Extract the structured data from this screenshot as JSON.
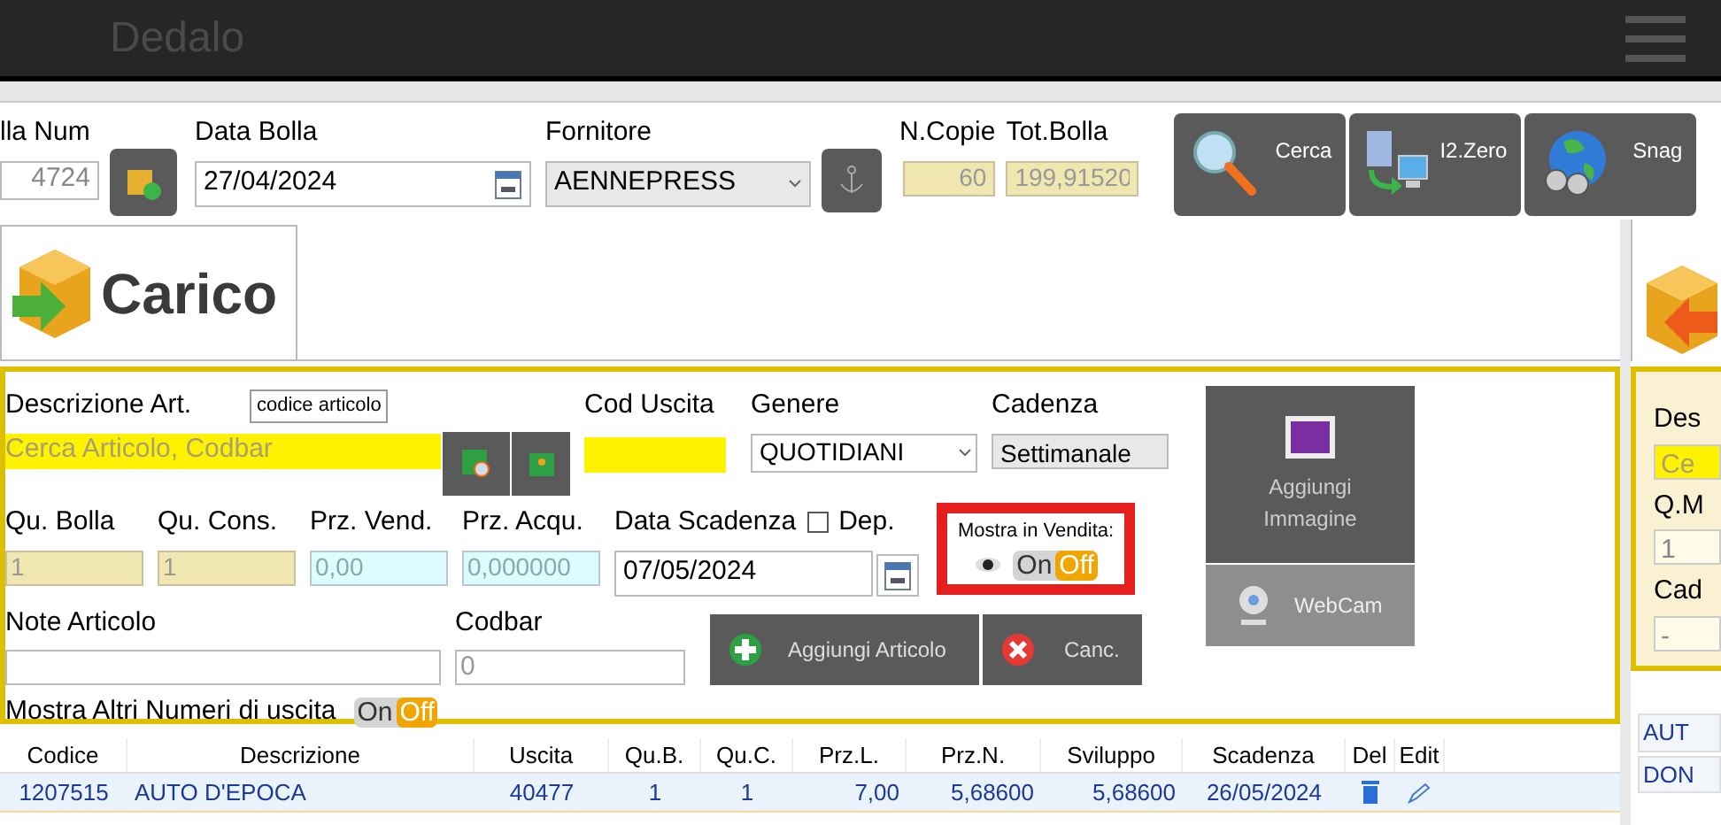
{
  "app_bar": {
    "title": "Dedalo"
  },
  "header": {
    "bolla_num": {
      "label": "lla Num",
      "value": "4724"
    },
    "data_bolla": {
      "label": "Data Bolla",
      "value": "27/04/2024"
    },
    "fornitore": {
      "label": "Fornitore",
      "value": "AENNEPRESS"
    },
    "n_copie": {
      "label": "N.Copie",
      "value": "60"
    },
    "tot_bolla": {
      "label": "Tot.Bolla",
      "value": "199,91520"
    },
    "toolbar_buttons": [
      {
        "kind": "search",
        "label": "Cerca"
      },
      {
        "kind": "transfer",
        "label": "I2.Zero"
      },
      {
        "kind": "globe",
        "label": "Snag"
      }
    ]
  },
  "tab": {
    "label": "Carico"
  },
  "form": {
    "descrizione": {
      "label": "Descrizione Art.",
      "mode": "codice articolo",
      "placeholder": "Cerca Articolo, Codbar"
    },
    "cod_uscita": {
      "label": "Cod Uscita"
    },
    "genere": {
      "label": "Genere",
      "value": "QUOTIDIANI"
    },
    "cadenza": {
      "label": "Cadenza",
      "value": "Settimanale"
    },
    "qty_fields": [
      {
        "label": "Qu. Bolla",
        "value": "1",
        "kind": "quantity"
      },
      {
        "label": "Qu. Cons.",
        "value": "1",
        "kind": "quantity"
      },
      {
        "label": "Prz. Vend.",
        "value": "0,00",
        "kind": "price"
      },
      {
        "label": "Prz. Acqu.",
        "value": "0,000000",
        "kind": "price"
      }
    ],
    "data_scadenza": {
      "label": "Data Scadenza",
      "value": "07/05/2024"
    },
    "deposito": {
      "label": "Dep.",
      "checked": false
    },
    "mostra_in_vendita": {
      "label": "Mostra in Vendita:",
      "on": false,
      "on_label": "On",
      "off_label": "Off"
    },
    "note_articolo": {
      "label": "Note Articolo"
    },
    "codbar": {
      "label": "Codbar",
      "value": "0"
    },
    "aggiungi_articolo": {
      "label": "Aggiungi Articolo"
    },
    "cancella": {
      "label": "Canc."
    },
    "aggiungi_immagine": {
      "label": "Aggiungi Immagine"
    },
    "webcam": {
      "label": "WebCam"
    },
    "mostra_altri": {
      "label": "Mostra Altri Numeri di uscita",
      "on": false,
      "on_label": "On",
      "off_label": "Off"
    }
  },
  "table": {
    "columns": [
      "Codice",
      "Descrizione",
      "Uscita",
      "Qu.B.",
      "Qu.C.",
      "Prz.L.",
      "Prz.N.",
      "Sviluppo",
      "Scadenza",
      "Del",
      "Edit"
    ],
    "rows": [
      {
        "cells": [
          "1207515",
          "AUTO D'EPOCA",
          "40477",
          "1",
          "1",
          "7,00",
          "5,68600",
          "5,68600",
          "26/05/2024"
        ],
        "selected": true
      }
    ]
  },
  "side_panel": {
    "labels": [
      "Des",
      "Q.M",
      "Cad"
    ],
    "fields": [
      "Ce",
      "1",
      "-"
    ],
    "list": [
      "AUT",
      "DON"
    ]
  }
}
